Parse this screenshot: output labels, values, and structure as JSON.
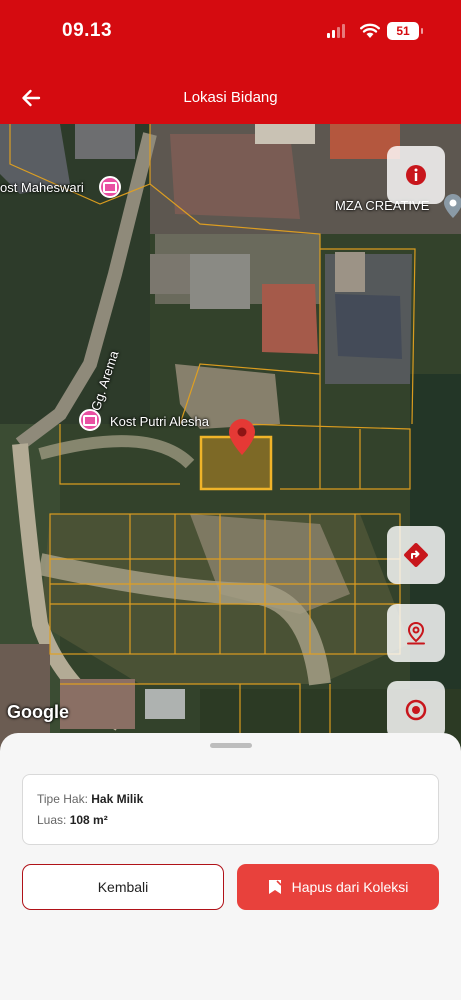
{
  "status_bar": {
    "time": "09.13",
    "battery": "51"
  },
  "header": {
    "title": "Lokasi Bidang",
    "back_icon": "arrow-left-icon"
  },
  "map": {
    "labels": {
      "maheswari": "ost Maheswari",
      "mza": "MZA CREATIVE",
      "road": "Gg. Arema",
      "alesha": "Kost Putri Alesha"
    },
    "attribution": "Google",
    "buttons": {
      "info_icon": "info-icon",
      "directions_icon": "directions-icon",
      "location_icon": "location-pin-icon",
      "target_icon": "target-icon"
    }
  },
  "detail": {
    "tipe_hak_label": "Tipe Hak:",
    "tipe_hak_value": "Hak Milik",
    "luas_label": "Luas:",
    "luas_value": "108 m²"
  },
  "actions": {
    "back_label": "Kembali",
    "delete_label": "Hapus dari Koleksi",
    "delete_icon": "bookmark-remove-icon"
  },
  "colors": {
    "primary": "#d50b10",
    "delete_button": "#e8413c",
    "parcel_line": "#e3a11f",
    "marker": "#e53935"
  }
}
